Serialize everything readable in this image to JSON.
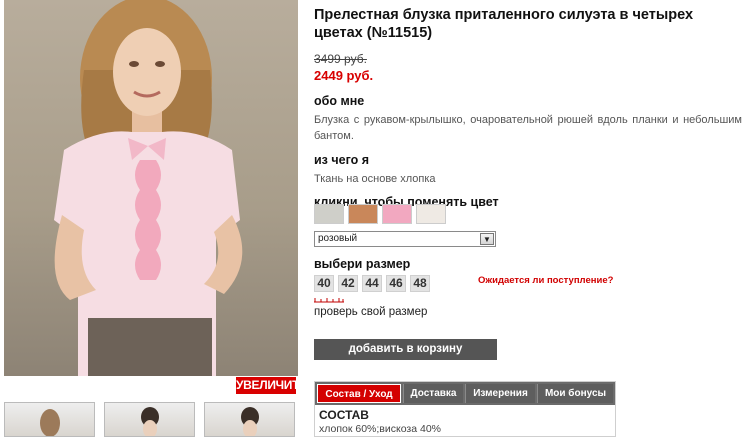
{
  "product": {
    "title": "Прелестная блузка приталенного силуэта в четырех цветах (№11515)",
    "old_price": "3499 руб.",
    "new_price": "2449 руб."
  },
  "about": {
    "heading": "обо мне",
    "text": "Блузка с рукавом-крылышко, очаровательной рюшей вдоль планки и небольшим бантом."
  },
  "material": {
    "heading": "из чего я",
    "text": "Ткань на основе хлопка"
  },
  "color": {
    "heading": "кликни, чтобы поменять цвет",
    "swatches": [
      {
        "name": "grey",
        "color": "#cfcfc9"
      },
      {
        "name": "orange",
        "color": "#c9875a"
      },
      {
        "name": "pink",
        "color": "#f2a8c0"
      },
      {
        "name": "white",
        "color": "#efeae4"
      }
    ],
    "selected": "розовый"
  },
  "size": {
    "heading": "выбери размер",
    "options": [
      "40",
      "42",
      "44",
      "46",
      "48"
    ],
    "awaiting_link": "Ожидается ли поступление?",
    "check_link": "проверь свой размер"
  },
  "gallery": {
    "zoom_label": "УВЕЛИЧИТЬ"
  },
  "cart": {
    "button_label": "добавить в корзину"
  },
  "tabs": {
    "items": [
      "Состав / Уход",
      "Доставка",
      "Измерения",
      "Мои бонусы"
    ],
    "content_heading": "СОСТАВ",
    "content_text": "хлопок 60%;вискоза 40%"
  },
  "colors": {
    "accent": "#d40000",
    "button_dark": "#555555"
  }
}
